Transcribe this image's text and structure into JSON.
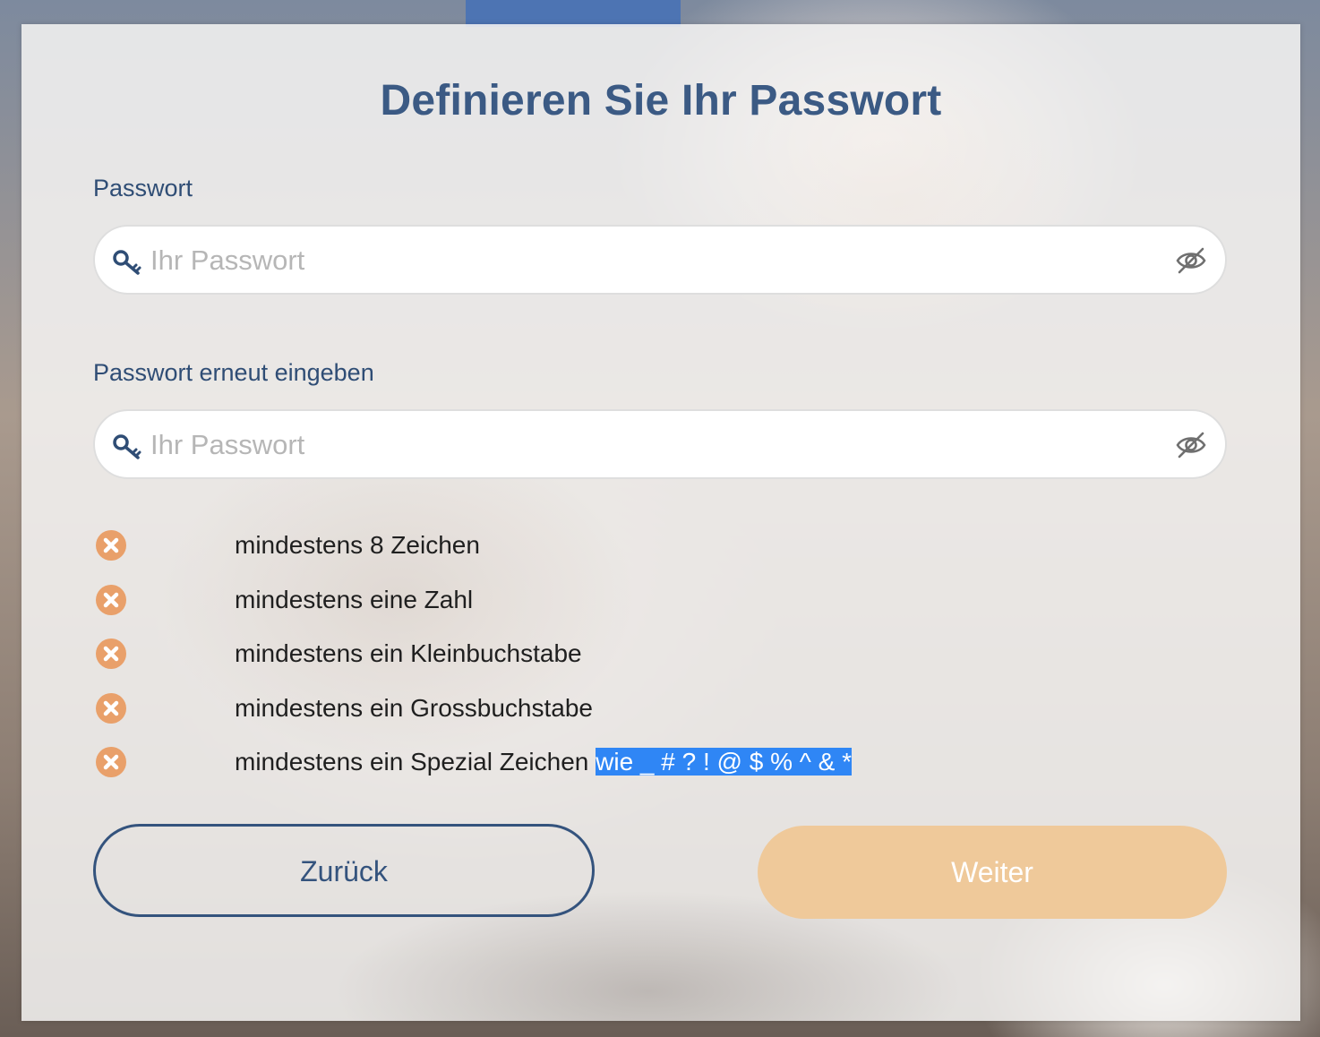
{
  "page": {
    "title": "Definieren Sie Ihr Passwort"
  },
  "password_field": {
    "label": "Passwort",
    "placeholder": "Ihr Passwort",
    "value": ""
  },
  "confirm_field": {
    "label": "Passwort erneut eingeben",
    "placeholder": "Ihr Passwort",
    "value": ""
  },
  "rules": [
    {
      "text": "mindestens 8 Zeichen",
      "selected": "",
      "status": "unmet"
    },
    {
      "text": "mindestens eine Zahl",
      "selected": "",
      "status": "unmet"
    },
    {
      "text": "mindestens ein Kleinbuchstabe",
      "selected": "",
      "status": "unmet"
    },
    {
      "text": "mindestens ein Grossbuchstabe",
      "selected": "",
      "status": "unmet"
    },
    {
      "text": "mindestens ein Spezial Zeichen ",
      "selected": "wie _ # ? ! @ $ % ^ & *",
      "status": "unmet"
    }
  ],
  "buttons": {
    "back_label": "Zurück",
    "next_label": "Weiter"
  },
  "colors": {
    "title": "#3b5a84",
    "unmet_icon": "#e9a06a",
    "next_button": "#efc99a",
    "back_border": "#34537d",
    "selection": "#2f86f5"
  },
  "icons": {
    "field_icon": "key-icon",
    "visibility_toggle": "eye-slash-icon",
    "rule_status": "x-circle-icon"
  }
}
